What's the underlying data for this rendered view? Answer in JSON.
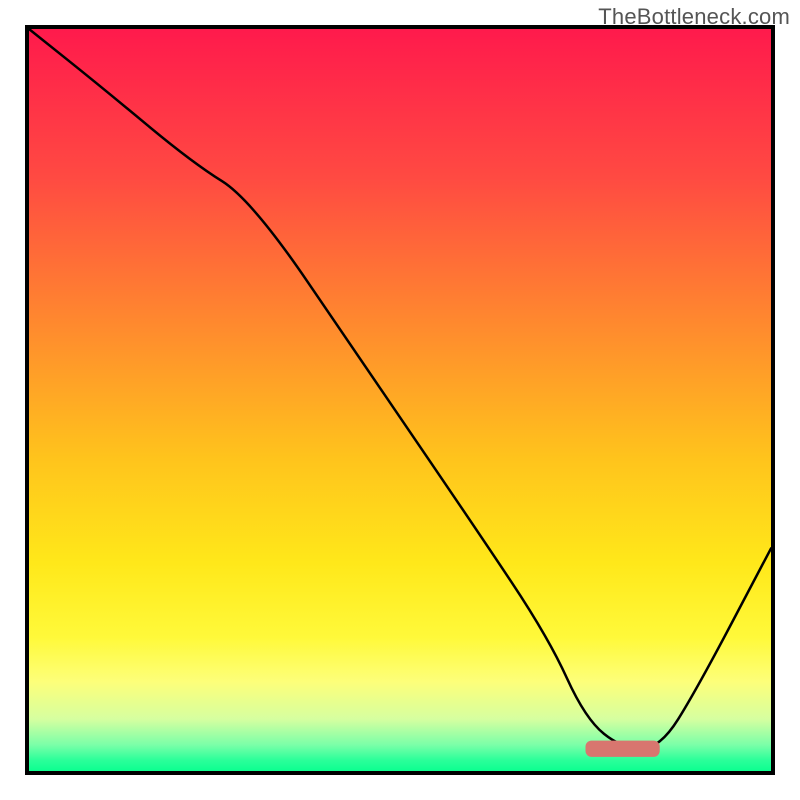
{
  "watermark": "TheBottleneck.com",
  "chart_data": {
    "type": "line",
    "title": "",
    "xlabel": "",
    "ylabel": "",
    "xlim": [
      0,
      100
    ],
    "ylim": [
      0,
      100
    ],
    "grid": false,
    "legend": false,
    "gradient_stops": [
      {
        "offset": 0.0,
        "color": "#ff1a4c"
      },
      {
        "offset": 0.2,
        "color": "#ff4a42"
      },
      {
        "offset": 0.4,
        "color": "#ff8a2e"
      },
      {
        "offset": 0.58,
        "color": "#ffc41c"
      },
      {
        "offset": 0.72,
        "color": "#ffe81a"
      },
      {
        "offset": 0.82,
        "color": "#fff93a"
      },
      {
        "offset": 0.88,
        "color": "#fdff7a"
      },
      {
        "offset": 0.93,
        "color": "#d6ffa0"
      },
      {
        "offset": 0.965,
        "color": "#7affa8"
      },
      {
        "offset": 0.985,
        "color": "#2cff9a"
      },
      {
        "offset": 1.0,
        "color": "#0cff90"
      }
    ],
    "series": [
      {
        "name": "bottleneck-curve",
        "color": "#000000",
        "x": [
          0,
          10,
          22,
          30,
          45,
          60,
          70,
          75,
          80,
          85,
          90,
          100
        ],
        "y": [
          100,
          92,
          82,
          77,
          55,
          33,
          18,
          7,
          3,
          3,
          11,
          30
        ]
      }
    ],
    "marker": {
      "x_start": 75,
      "x_end": 85,
      "y": 3,
      "height": 2.2,
      "color": "#d8766f"
    }
  }
}
